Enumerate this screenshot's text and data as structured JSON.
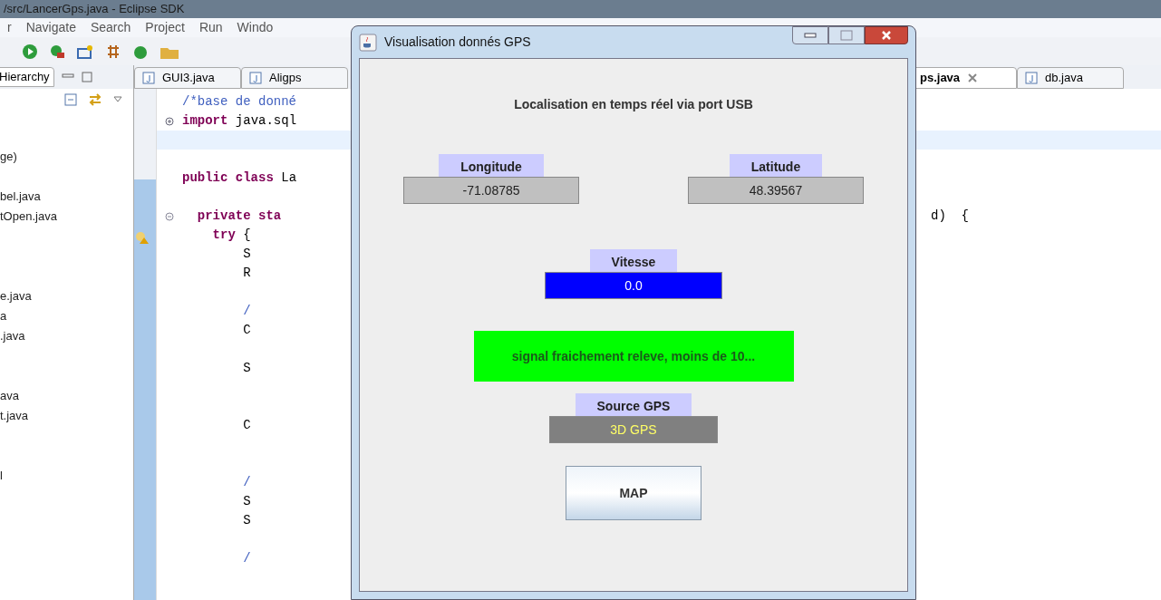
{
  "window": {
    "title": "/src/LancerGps.java - Eclipse SDK"
  },
  "menu": [
    "r",
    "Navigate",
    "Search",
    "Project",
    "Run",
    "Windo"
  ],
  "left_panel": {
    "tab": "Hierarchy",
    "items": [
      "ge)",
      "bel.java",
      "tOpen.java",
      "e.java",
      "a",
      ".java",
      "ava",
      "t.java",
      "l"
    ]
  },
  "editor_tabs": [
    {
      "label": "GUI3.java",
      "selected": false
    },
    {
      "label": "Aligps",
      "selected": false
    },
    {
      "label": "ps.java",
      "selected": true
    },
    {
      "label": "db.java",
      "selected": false
    }
  ],
  "code_lines": [
    {
      "kind": "comment",
      "text": "/*base de donné"
    },
    {
      "kind": "keyword",
      "keyword": "import",
      "text": "java.sql"
    },
    {
      "kind": "keyword",
      "keyword": "public class",
      "text": "La"
    },
    {
      "kind": "keyword",
      "keyword": "private sta"
    },
    {
      "kind": "keyword",
      "keyword": "try",
      "text": "{"
    },
    {
      "kind": "plain",
      "text": "S"
    },
    {
      "kind": "plain",
      "text": "R"
    },
    {
      "kind": "comment",
      "text": "/"
    },
    {
      "kind": "plain",
      "text": "C"
    },
    {
      "kind": "plain",
      "text": "S"
    },
    {
      "kind": "plain",
      "text": "C"
    },
    {
      "kind": "comment",
      "text": "/"
    },
    {
      "kind": "plain",
      "text": "S"
    },
    {
      "kind": "plain",
      "text": "S"
    },
    {
      "kind": "comment",
      "text": "/"
    }
  ],
  "code_right": "d)  {",
  "dialog": {
    "title": "Visualisation donnés GPS",
    "heading": "Localisation en temps réel via port USB",
    "longitude": {
      "label": "Longitude",
      "value": "-71.08785"
    },
    "latitude": {
      "label": "Latitude",
      "value": "48.39567"
    },
    "speed": {
      "label": "Vitesse",
      "value": "0.0",
      "color": "#0000ff"
    },
    "signal": {
      "text": "signal fraichement releve, moins de 10...",
      "color": "#00ff00"
    },
    "source": {
      "label": "Source GPS",
      "value": "3D GPS"
    },
    "button": "MAP"
  }
}
